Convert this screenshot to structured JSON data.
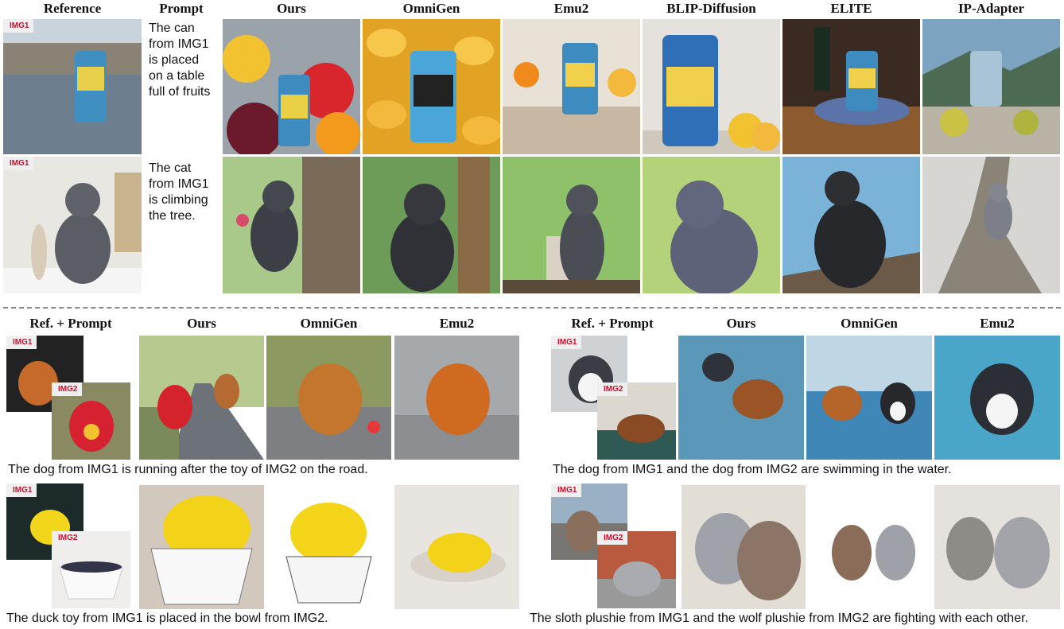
{
  "top": {
    "headers": [
      "Reference",
      "Prompt",
      "Ours",
      "OmniGen",
      "Emu2",
      "BLIP-Diffusion",
      "ELITE",
      "IP-Adapter"
    ],
    "rows": [
      {
        "tag": "IMG1",
        "prompt": [
          "The can",
          "from IMG1",
          "is placed",
          "on a table",
          "full of fruits"
        ]
      },
      {
        "tag": "IMG1",
        "prompt": [
          "The cat",
          "from IMG1",
          "is climbing",
          "the tree."
        ]
      }
    ]
  },
  "bottom_left": {
    "headers": [
      "Ref. + Prompt",
      "Ours",
      "OmniGen",
      "Emu2"
    ],
    "rows": [
      {
        "tag1": "IMG1",
        "tag2": "IMG2",
        "caption": "The dog from IMG1 is running after the toy of IMG2 on the road."
      },
      {
        "tag1": "IMG1",
        "tag2": "IMG2",
        "caption": "The duck toy from IMG1 is placed in the bowl from IMG2."
      }
    ]
  },
  "bottom_right": {
    "headers": [
      "Ref. + Prompt",
      "Ours",
      "OmniGen",
      "Emu2"
    ],
    "rows": [
      {
        "tag1": "IMG1",
        "tag2": "IMG2",
        "caption": "The dog from IMG1 and the dog from IMG2 are swimming in the water."
      },
      {
        "tag1": "IMG1",
        "tag2": "IMG2",
        "caption": "The sloth plushie from IMG1 and the wolf plushie from IMG2 are fighting with each other."
      }
    ]
  }
}
